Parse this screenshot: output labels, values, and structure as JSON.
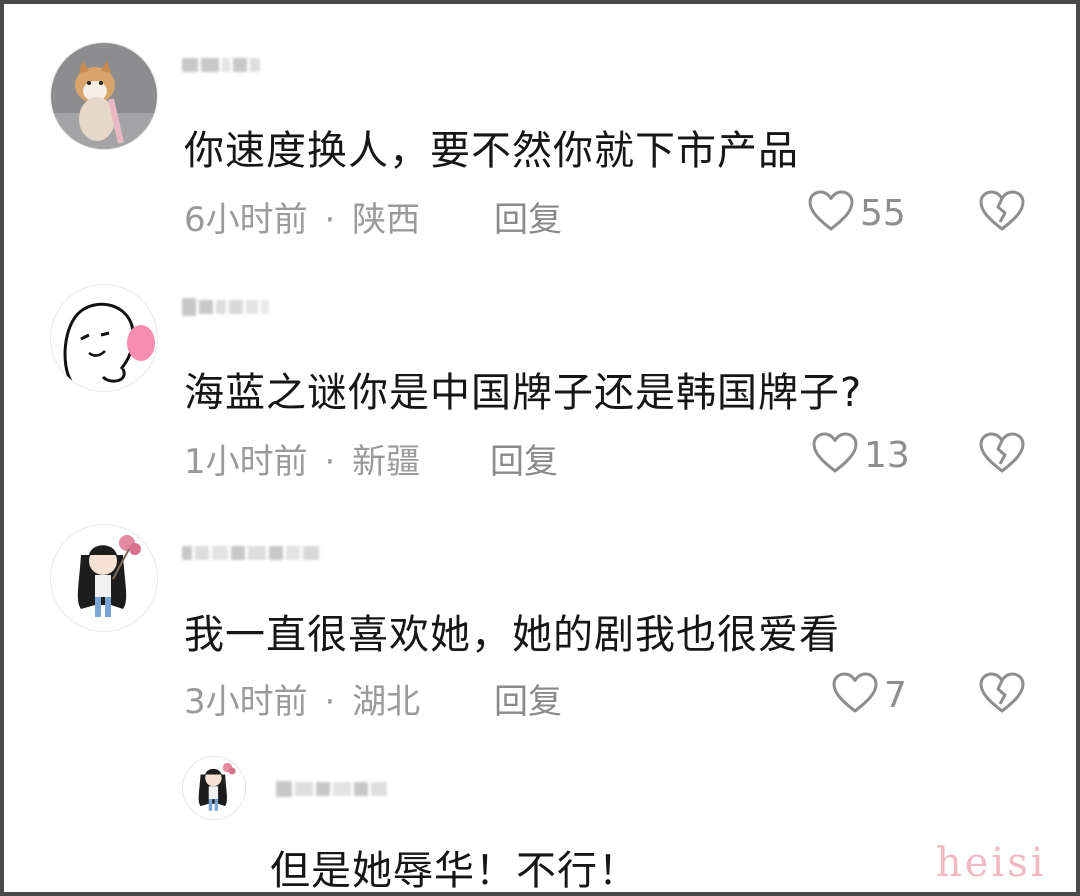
{
  "comments": [
    {
      "text": "你速度换人，要不然你就下市产品",
      "time": "6小时前",
      "location": "陕西",
      "reply_label": "回复",
      "likes": "55"
    },
    {
      "text": "海蓝之谜你是中国牌子还是韩国牌子?",
      "time": "1小时前",
      "location": "新疆",
      "reply_label": "回复",
      "likes": "13"
    },
    {
      "text": "我一直很喜欢她，她的剧我也很爱看",
      "time": "3小时前",
      "location": "湖北",
      "reply_label": "回复",
      "likes": "7"
    }
  ],
  "reply": {
    "text": "但是她辱华！不行！"
  },
  "separator": "·",
  "watermark": "heisi",
  "colors": {
    "text": "#161616",
    "meta": "#9a9a9a",
    "border": "#4a4a4a",
    "watermark": "#f0b9c4"
  },
  "icons": {
    "like": "heart-outline-icon",
    "dislike": "broken-heart-icon"
  }
}
